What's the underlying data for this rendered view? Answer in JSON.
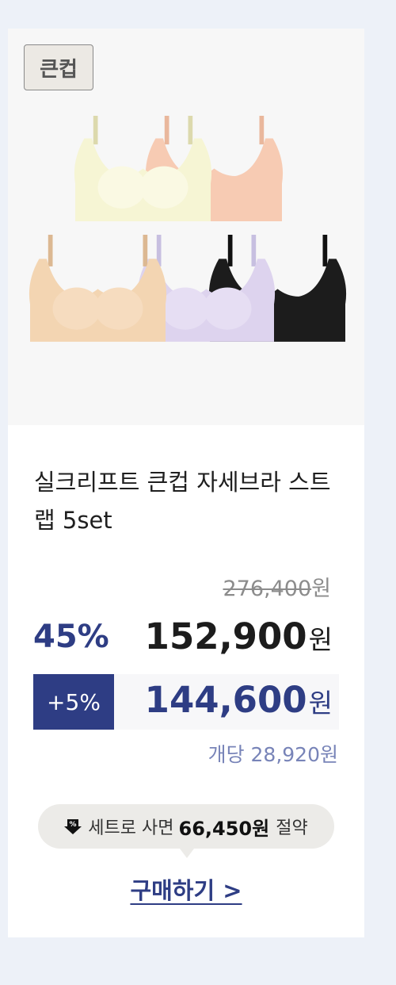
{
  "card": {
    "tag": "큰컵",
    "title": "실크리프트 큰컵 자세브라 스트랩 5set",
    "original_price": "276,400",
    "currency": "원",
    "discount_percent": "45%",
    "sale_price": "152,900",
    "extra_discount": "+5%",
    "extra_price": "144,600",
    "unit_price": "개당 28,920원",
    "set_saving": {
      "prefix": "세트로 사면",
      "amount": "66,450원",
      "suffix": "절약",
      "icon": "discount-down-arrow-icon"
    },
    "buy_label": "구매하기 >",
    "product_colors": [
      "#f6f5d4",
      "#f7cbb3",
      "#f3d5b2",
      "#ddd3ee",
      "#1c1c1c"
    ],
    "accent_color": "#2e3d84"
  }
}
